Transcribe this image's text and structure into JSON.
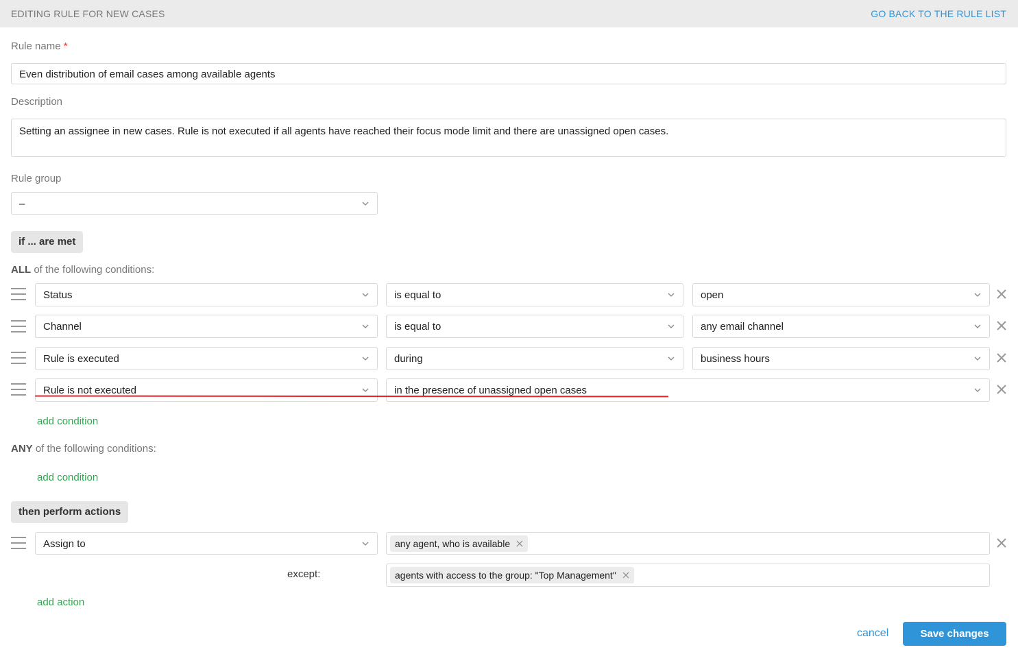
{
  "header": {
    "title": "EDITING RULE FOR NEW CASES",
    "back_link": "GO BACK TO THE RULE LIST"
  },
  "rule_name": {
    "label": "Rule name",
    "required_mark": "*",
    "value": "Even distribution of email cases among available agents"
  },
  "description": {
    "label": "Description",
    "value": "Setting an assignee in new cases. Rule is not executed if all agents have reached their focus mode limit and there are unassigned open cases."
  },
  "rule_group": {
    "label": "Rule group",
    "value": "–"
  },
  "conditions": {
    "section_label": "if ... are met",
    "all_label_bold": "ALL",
    "all_label_rest": " of the following conditions:",
    "all_rows": [
      {
        "field": "Status",
        "operator": "is equal to",
        "value": "open"
      },
      {
        "field": "Channel",
        "operator": "is equal to",
        "value": "any email channel"
      },
      {
        "field": "Rule is executed",
        "operator": "during",
        "value": "business hours"
      },
      {
        "field": "Rule is not executed",
        "operator": "in the presence of unassigned open cases"
      }
    ],
    "add_condition_label": "add condition",
    "any_label_bold": "ANY",
    "any_label_rest": " of the following conditions:",
    "any_add_condition_label": "add condition"
  },
  "actions": {
    "section_label": "then perform actions",
    "rows": [
      {
        "action": "Assign to",
        "tag": "any agent, who is available",
        "except_label": "except:",
        "except_tag": "agents with access to the group: \"Top Management\""
      }
    ],
    "add_action_label": "add action"
  },
  "footer": {
    "cancel_label": "cancel",
    "save_label": "Save changes"
  },
  "colors": {
    "accent_blue": "#2f95d8",
    "link_green": "#2fa84f",
    "annotation_red": "#e3242b"
  }
}
